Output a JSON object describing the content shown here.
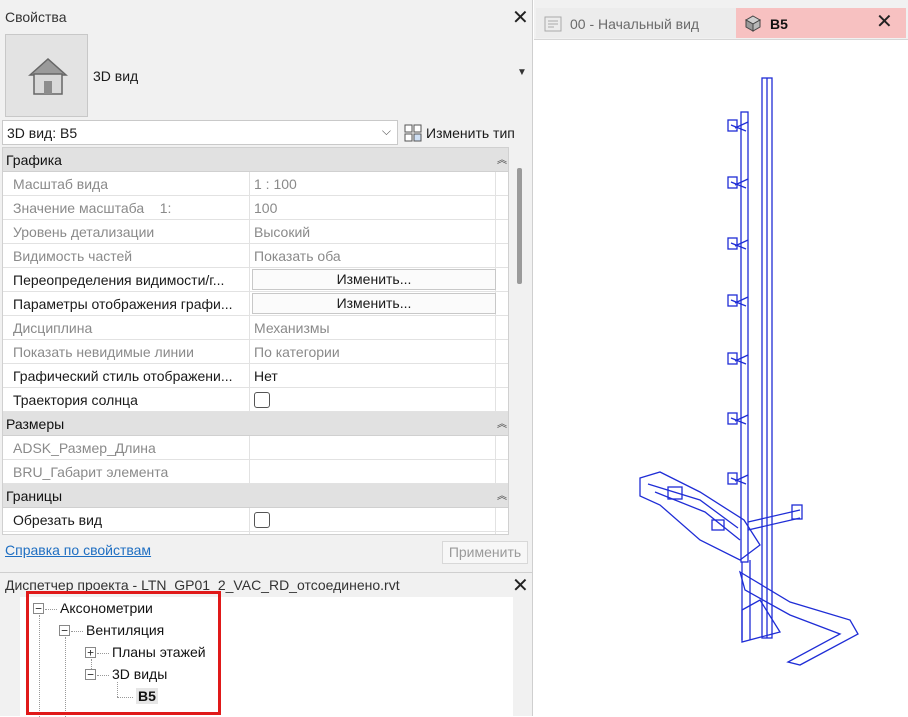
{
  "properties": {
    "title": "Свойства",
    "type_name": "3D вид",
    "view_selector": "3D вид: В5",
    "edit_type": "Изменить тип",
    "groups": {
      "graphics": "Графика",
      "dimensions": "Размеры",
      "extents": "Границы"
    },
    "rows": {
      "scale": {
        "name": "Масштаб вида",
        "value": "1 : 100"
      },
      "scale_value": {
        "name": "Значение масштаба    1:",
        "value": "100"
      },
      "detail_level": {
        "name": "Уровень детализации",
        "value": "Высокий"
      },
      "parts_visibility": {
        "name": "Видимость частей",
        "value": "Показать оба"
      },
      "vg_overrides": {
        "name": "Переопределения видимости/г...",
        "value": "Изменить..."
      },
      "graphic_display": {
        "name": "Параметры отображения графи...",
        "value": "Изменить..."
      },
      "discipline": {
        "name": "Дисциплина",
        "value": "Механизмы"
      },
      "hidden_lines": {
        "name": "Показать невидимые линии",
        "value": "По категории"
      },
      "graphic_style": {
        "name": "Графический стиль отображени...",
        "value": "Нет"
      },
      "sun_path": {
        "name": "Траектория солнца",
        "checked": false
      },
      "adsk_length": {
        "name": "ADSK_Размер_Длина",
        "value": ""
      },
      "bru_size": {
        "name": "BRU_Габарит элемента",
        "value": ""
      },
      "crop_view": {
        "name": "Обрезать вид",
        "checked": false
      }
    },
    "help_link": "Справка по свойствам",
    "apply": "Применить"
  },
  "browser": {
    "title": "Диспетчер проекта - LTN_GP01_2_VAC_RD_отсоединено.rvt",
    "nodes": {
      "axonometry": "Аксонометрии",
      "ventilation": "Вентиляция",
      "floor_plans": "Планы этажей",
      "views3d": "3D виды",
      "b5": "В5"
    }
  },
  "tabs": {
    "start_view": "00 - Начальный вид",
    "b5": "В5"
  },
  "colors": {
    "model_lines": "#1f2dd6",
    "active_tab": "#f7c1c1",
    "highlight_box": "#e01919",
    "link": "#1f6fc2"
  },
  "icons": [
    "house-icon",
    "close-icon",
    "chevron-down-icon",
    "edit-type-icon",
    "collapse-icon",
    "cube-icon",
    "start-view-icon",
    "tree-toggle-icon"
  ]
}
